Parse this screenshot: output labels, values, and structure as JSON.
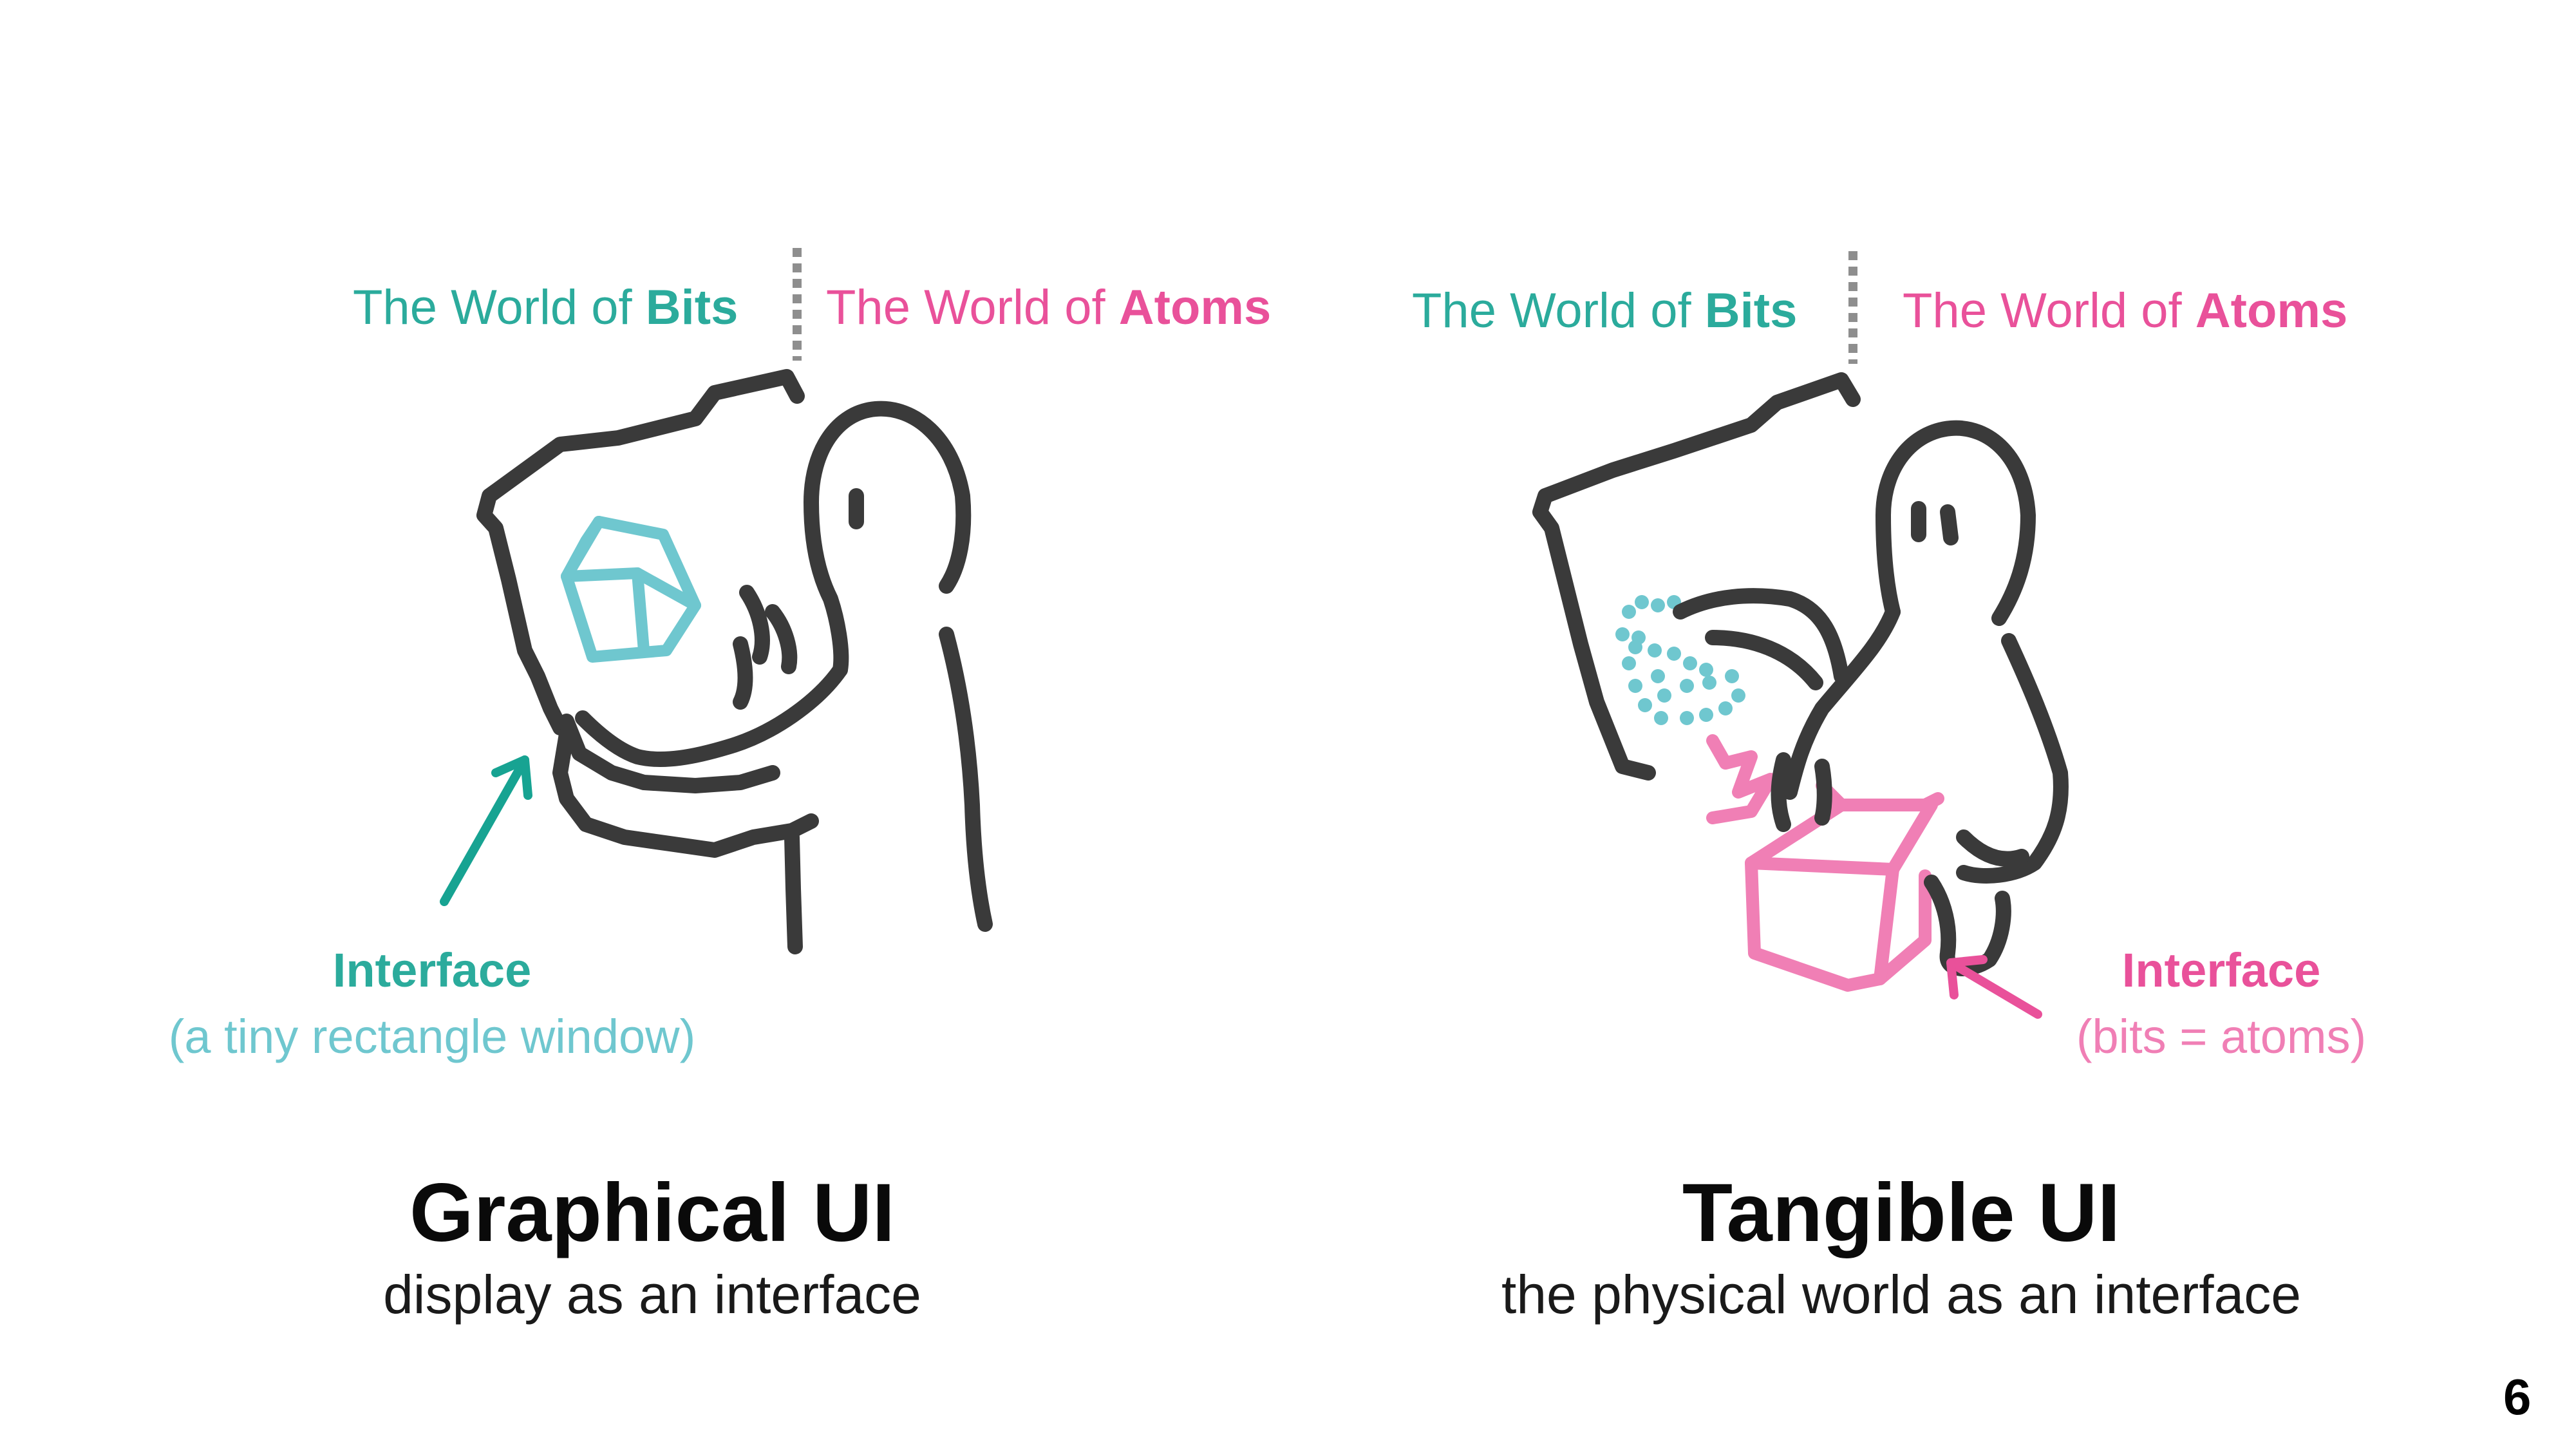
{
  "left_panel": {
    "bits_prefix": "The World of ",
    "bits_word": "Bits",
    "atoms_prefix": "The World of ",
    "atoms_word": "Atoms",
    "interface_title": "Interface",
    "interface_note": "(a tiny rectangle window)",
    "title": "Graphical UI",
    "subtitle": "display as an interface"
  },
  "right_panel": {
    "bits_prefix": "The World of ",
    "bits_word": "Bits",
    "atoms_prefix": "The World of ",
    "atoms_word": "Atoms",
    "interface_title": "Interface",
    "interface_note": "(bits = atoms)",
    "title": "Tangible UI",
    "subtitle": "the physical world as an interface"
  },
  "page_number": "6",
  "colors": {
    "bits": "#2bab9c",
    "atoms": "#e9519a",
    "digital_cube": "#6fc7cf",
    "physical_cube": "#f07fb5",
    "ink": "#3a3a3a"
  }
}
